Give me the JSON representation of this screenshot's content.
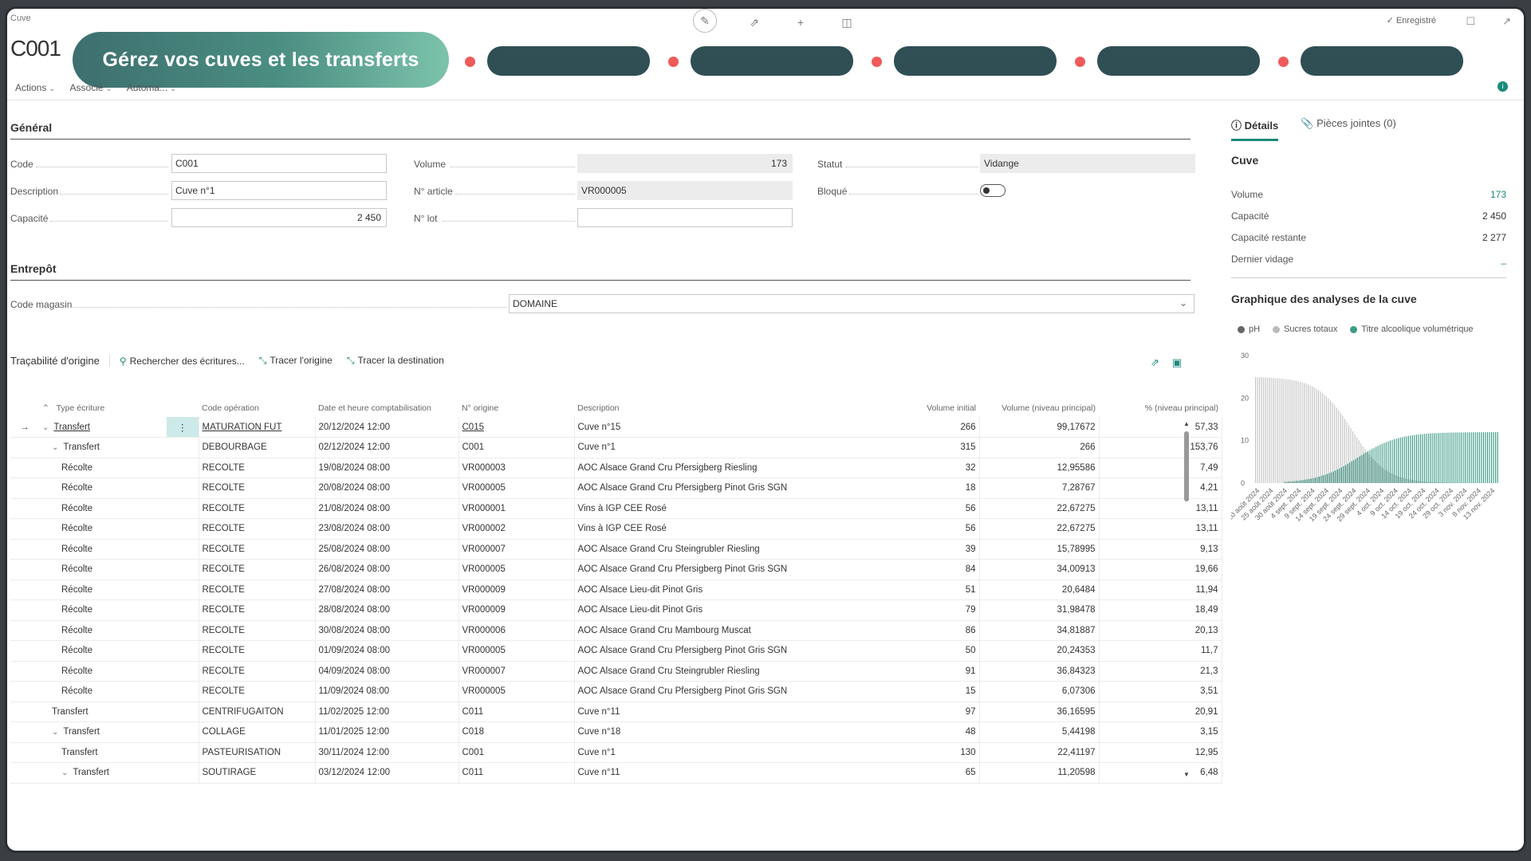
{
  "window": {
    "top_label": "Cuve",
    "title": "C001",
    "saved": "✓ Enregistré"
  },
  "banner": {
    "text": "Gérez vos cuves et les transferts"
  },
  "actionbar": [
    "Actions",
    "Associé",
    "Automa..."
  ],
  "general": {
    "title": "Général",
    "fields": {
      "code": {
        "label": "Code",
        "value": "C001"
      },
      "description": {
        "label": "Description",
        "value": "Cuve n°1"
      },
      "capacite": {
        "label": "Capacité",
        "value": "2 450"
      },
      "volume": {
        "label": "Volume",
        "value": "173"
      },
      "article": {
        "label": "N° article",
        "value": "VR000005"
      },
      "lot": {
        "label": "N° lot",
        "value": ""
      },
      "statut": {
        "label": "Statut",
        "value": "Vidange"
      },
      "bloque": {
        "label": "Bloqué",
        "value": false
      }
    }
  },
  "entrepot": {
    "title": "Entrepôt",
    "code_magasin": {
      "label": "Code magasin",
      "value": "DOMAINE"
    }
  },
  "traceability": {
    "title": "Traçabilité d'origine",
    "actions": [
      "Rechercher des écritures...",
      "Tracer l'origine",
      "Tracer la destination"
    ],
    "columns": [
      "Type écriture",
      "Code opération",
      "Date et heure comptabilisation",
      "N° origine",
      "Description",
      "Volume initial",
      "Volume (niveau principal)",
      "% (niveau principal)"
    ],
    "rows": [
      {
        "type": "Transfert",
        "op": "MATURATION FUT",
        "date": "20/12/2024 12:00",
        "origine": "C015",
        "desc": "Cuve n°15",
        "vol_init": "266",
        "vol": "99,17672",
        "pct": "57,33"
      },
      {
        "type": "Transfert",
        "op": "DEBOURBAGE",
        "date": "02/12/2024 12:00",
        "origine": "C001",
        "desc": "Cuve n°1",
        "vol_init": "315",
        "vol": "266",
        "pct": "153,76"
      },
      {
        "type": "Récolte",
        "op": "RECOLTE",
        "date": "19/08/2024 08:00",
        "origine": "VR000003",
        "desc": "AOC Alsace Grand Cru Pfersigberg Riesling",
        "vol_init": "32",
        "vol": "12,95586",
        "pct": "7,49"
      },
      {
        "type": "Récolte",
        "op": "RECOLTE",
        "date": "20/08/2024 08:00",
        "origine": "VR000005",
        "desc": "AOC Alsace Grand Cru Pfersigberg Pinot Gris SGN",
        "vol_init": "18",
        "vol": "7,28767",
        "pct": "4,21"
      },
      {
        "type": "Récolte",
        "op": "RECOLTE",
        "date": "21/08/2024 08:00",
        "origine": "VR000001",
        "desc": "Vins à IGP CEE Rosé",
        "vol_init": "56",
        "vol": "22,67275",
        "pct": "13,11"
      },
      {
        "type": "Récolte",
        "op": "RECOLTE",
        "date": "23/08/2024 08:00",
        "origine": "VR000002",
        "desc": "Vins à IGP CEE Rosé",
        "vol_init": "56",
        "vol": "22,67275",
        "pct": "13,11"
      },
      {
        "type": "Récolte",
        "op": "RECOLTE",
        "date": "25/08/2024 08:00",
        "origine": "VR000007",
        "desc": "AOC Alsace Grand Cru Steingrubler Riesling",
        "vol_init": "39",
        "vol": "15,78995",
        "pct": "9,13"
      },
      {
        "type": "Récolte",
        "op": "RECOLTE",
        "date": "26/08/2024 08:00",
        "origine": "VR000005",
        "desc": "AOC Alsace Grand Cru Pfersigberg Pinot Gris SGN",
        "vol_init": "84",
        "vol": "34,00913",
        "pct": "19,66"
      },
      {
        "type": "Récolte",
        "op": "RECOLTE",
        "date": "27/08/2024 08:00",
        "origine": "VR000009",
        "desc": "AOC Alsace Lieu-dit Pinot Gris",
        "vol_init": "51",
        "vol": "20,6484",
        "pct": "11,94"
      },
      {
        "type": "Récolte",
        "op": "RECOLTE",
        "date": "28/08/2024 08:00",
        "origine": "VR000009",
        "desc": "AOC Alsace Lieu-dit Pinot Gris",
        "vol_init": "79",
        "vol": "31,98478",
        "pct": "18,49"
      },
      {
        "type": "Récolte",
        "op": "RECOLTE",
        "date": "30/08/2024 08:00",
        "origine": "VR000006",
        "desc": "AOC Alsace Grand Cru Mambourg Muscat",
        "vol_init": "86",
        "vol": "34,81887",
        "pct": "20,13"
      },
      {
        "type": "Récolte",
        "op": "RECOLTE",
        "date": "01/09/2024 08:00",
        "origine": "VR000005",
        "desc": "AOC Alsace Grand Cru Pfersigberg Pinot Gris SGN",
        "vol_init": "50",
        "vol": "20,24353",
        "pct": "11,7"
      },
      {
        "type": "Récolte",
        "op": "RECOLTE",
        "date": "04/09/2024 08:00",
        "origine": "VR000007",
        "desc": "AOC Alsace Grand Cru Steingrubler Riesling",
        "vol_init": "91",
        "vol": "36,84323",
        "pct": "21,3"
      },
      {
        "type": "Récolte",
        "op": "RECOLTE",
        "date": "11/09/2024 08:00",
        "origine": "VR000005",
        "desc": "AOC Alsace Grand Cru Pfersigberg Pinot Gris SGN",
        "vol_init": "15",
        "vol": "6,07306",
        "pct": "3,51"
      },
      {
        "type": "Transfert",
        "op": "CENTRIFUGAITON",
        "date": "11/02/2025 12:00",
        "origine": "C011",
        "desc": "Cuve n°11",
        "vol_init": "97",
        "vol": "36,16595",
        "pct": "20,91"
      },
      {
        "type": "Transfert",
        "op": "COLLAGE",
        "date": "11/01/2025 12:00",
        "origine": "C018",
        "desc": "Cuve n°18",
        "vol_init": "48",
        "vol": "5,44198",
        "pct": "3,15"
      },
      {
        "type": "Transfert",
        "op": "PASTEURISATION",
        "date": "30/11/2024 12:00",
        "origine": "C001",
        "desc": "Cuve n°1",
        "vol_init": "130",
        "vol": "22,41197",
        "pct": "12,95"
      },
      {
        "type": "Transfert",
        "op": "SOUTIRAGE",
        "date": "03/12/2024 12:00",
        "origine": "C011",
        "desc": "Cuve n°11",
        "vol_init": "65",
        "vol": "11,20598",
        "pct": "6,48"
      }
    ]
  },
  "right_panel": {
    "tabs": [
      "Détails",
      "Pièces jointes (0)"
    ],
    "cuve_title": "Cuve",
    "facts": [
      {
        "label": "Volume",
        "value": "173"
      },
      {
        "label": "Capacité",
        "value": "2 450"
      },
      {
        "label": "Capacité restante",
        "value": "2 277"
      },
      {
        "label": "Dernier vidage",
        "value": "_"
      }
    ],
    "chart_title": "Graphique des analyses de la cuve"
  },
  "colors": {
    "accent": "#1b8a7a",
    "ph": "#666666",
    "sucres": "#bbbbbb",
    "titre": "#3d9c88"
  },
  "chart_data": {
    "type": "bar",
    "title": "Graphique des analyses de la cuve",
    "legend": [
      "pH",
      "Sucres totaux",
      "Titre alcoolique volumétrique"
    ],
    "ylim": [
      0,
      30
    ],
    "yticks": [
      "30",
      "20",
      "10",
      "0"
    ],
    "xticks": [
      "20 août 2024",
      "25 août 2024",
      "30 août 2024",
      "4 sept. 2024",
      "9 sept. 2024",
      "14 sept. 2024",
      "19 sept. 2024",
      "24 sept. 2024",
      "29 sept. 2024",
      "4 oct. 2024",
      "9 oct. 2024",
      "14 oct. 2024",
      "19 oct. 2024",
      "24 oct. 2024",
      "29 oct. 2024",
      "3 nov. 2024",
      "8 nov. 2024",
      "13 nov. 2024"
    ],
    "series": [
      {
        "name": "pH",
        "constant": 3.4
      },
      {
        "name": "Sucres totaux",
        "start": 25,
        "end": 0
      },
      {
        "name": "Titre alcoolique volumétrique",
        "start": 0,
        "end": 12
      }
    ],
    "legend_position": "top-left"
  }
}
